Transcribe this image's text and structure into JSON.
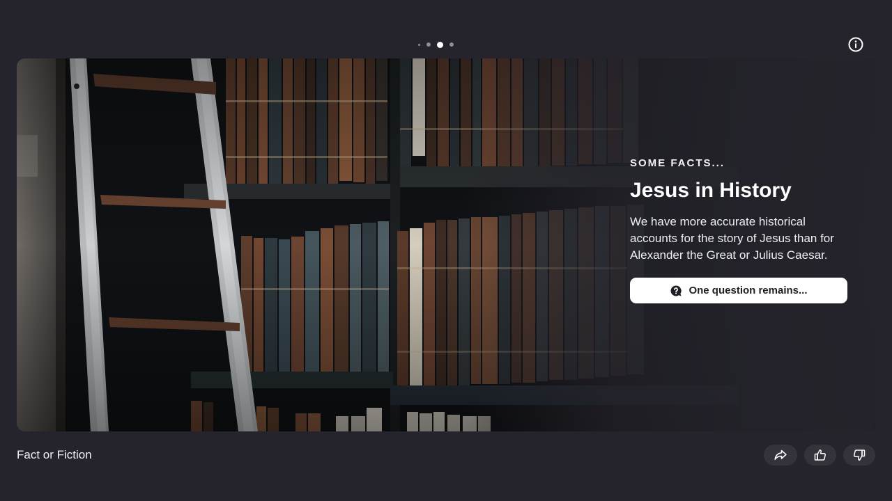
{
  "pager": {
    "total": 4,
    "active_index": 2
  },
  "info_icon": "info-circle-icon",
  "hero": {
    "eyebrow": "SOME FACTS...",
    "title": "Jesus in History",
    "description": "We have more accurate historical accounts for the story of Jesus than for Alexander the Great or Julius Caesar.",
    "cta_label": "One question remains...",
    "cta_icon": "question-bubble-icon",
    "image": "library-bookshelf-ladder"
  },
  "footer": {
    "title": "Fact or Fiction",
    "share_icon": "share-arrow-icon",
    "like_icon": "thumbs-up-icon",
    "dislike_icon": "thumbs-down-icon"
  },
  "colors": {
    "background": "#25242c",
    "button_bg": "#34333c",
    "cta_bg": "#ffffff",
    "text": "#ffffff"
  }
}
